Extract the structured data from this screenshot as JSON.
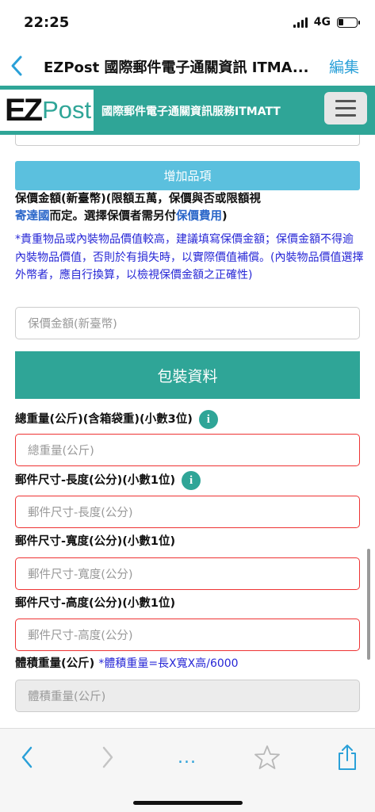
{
  "status": {
    "time": "22:25",
    "network": "4G"
  },
  "nav": {
    "title": "EZPost 國際郵件電子通關資訊 ITMA...",
    "edit": "編集"
  },
  "site": {
    "logo_ez": "EZ",
    "logo_post": "Post",
    "title": "國際郵件電子通關資訊服務ITMATT"
  },
  "form": {
    "add_item": "增加品項",
    "insured_label_1": "保價金額(新臺幣)(限額五萬，保價與否或限額視",
    "insured_label_2a": "寄達國",
    "insured_label_2b": "而定。選擇保價者需另付",
    "insured_label_2c": "保價費用",
    "insured_label_2d": ")",
    "insured_note": "*貴重物品或內裝物品價值較高，建議填寫保價金額；保價金額不得逾內裝物品價值，否則於有損失時，以實際價值補償。(內裝物品價值選擇外幣者，應自行換算，以檢視保價金額之正確性)",
    "insured_placeholder": "保價金額(新臺幣)",
    "section_packaging": "包裝資料",
    "weight_label": "總重量(公斤)(含箱袋重)(小數3位)",
    "weight_placeholder": "總重量(公斤)",
    "length_label": "郵件尺寸-長度(公分)(小數1位)",
    "length_placeholder": "郵件尺寸-長度(公分)",
    "width_label": "郵件尺寸-寬度(公分)(小數1位)",
    "width_placeholder": "郵件尺寸-寬度(公分)",
    "height_label": "郵件尺寸-高度(公分)(小數1位)",
    "height_placeholder": "郵件尺寸-高度(公分)",
    "volume_label": "體積重量(公斤)",
    "volume_note": "*體積重量=長X寬X高/6000",
    "volume_placeholder": "體積重量(公斤)",
    "info_glyph": "i"
  },
  "toolbar": {
    "more": "..."
  },
  "colors": {
    "teal": "#2fa597",
    "blue": "#2aa0d8",
    "button": "#5bc0de",
    "required": "#ee3333",
    "note": "#2727d6"
  }
}
